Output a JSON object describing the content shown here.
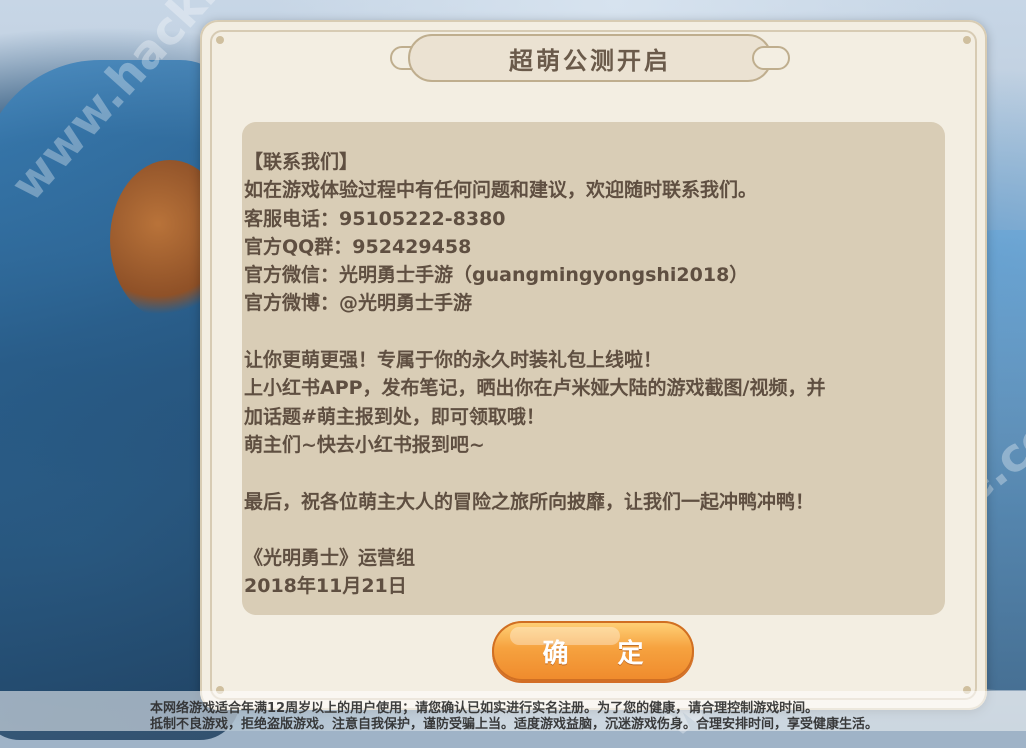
{
  "watermarks": {
    "top_left": "www.hackhome.com",
    "bottom_right": "www.hackhome.com"
  },
  "dialog": {
    "title": "超萌公测开启",
    "content_lines": [
      "【联系我们】",
      "如在游戏体验过程中有任何问题和建议，欢迎随时联系我们。",
      "客服电话：95105222-8380",
      "官方QQ群：952429458",
      "官方微信：光明勇士手游（guangmingyongshi2018）",
      "官方微博：@光明勇士手游",
      "",
      "让你更萌更强！专属于你的永久时装礼包上线啦！",
      "上小红书APP，发布笔记，晒出你在卢米娅大陆的游戏截图/视频，并",
      "加话题#萌主报到处，即可领取哦！",
      "萌主们~快去小红书报到吧~",
      "",
      "最后，祝各位萌主大人的冒险之旅所向披靡，让我们一起冲鸭冲鸭！",
      "",
      "《光明勇士》运营组",
      "2018年11月21日"
    ],
    "confirm_label": "确 定"
  },
  "footer": {
    "line1": "本网络游戏适合年满12周岁以上的用户使用；请您确认已如实进行实名注册。为了您的健康，请合理控制游戏时间。",
    "line2": "抵制不良游戏，拒绝盗版游戏。注意自我保护，谨防受骗上当。适度游戏益脑，沉迷游戏伤身。合理安排时间，享受健康生活。"
  },
  "colors": {
    "dialog_bg": "#f3eee2",
    "content_bg": "#d9cdb6",
    "text": "#5f4f41",
    "button_orange": "#f6a23f"
  }
}
